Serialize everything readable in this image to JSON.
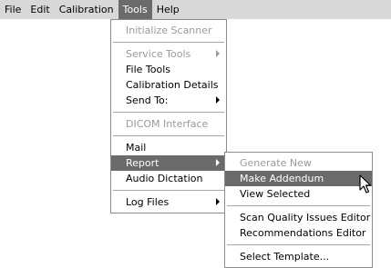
{
  "menubar": {
    "items": [
      {
        "label": "File"
      },
      {
        "label": "Edit"
      },
      {
        "label": "Calibration"
      },
      {
        "label": "Tools"
      },
      {
        "label": "Help"
      }
    ]
  },
  "tools_menu": {
    "initialize_scanner": "Initialize Scanner",
    "service_tools": "Service Tools",
    "file_tools": "File Tools",
    "calibration_details": "Calibration Details",
    "send_to": "Send To:",
    "dicom_interface": "DICOM Interface",
    "mail": "Mail",
    "report": "Report",
    "audio_dictation": "Audio Dictation",
    "log_files": "Log Files"
  },
  "report_menu": {
    "generate_new": "Generate New",
    "make_addendum": "Make Addendum",
    "view_selected": "View Selected",
    "scan_quality_issues_editor": "Scan Quality Issues Editor",
    "recommendations_editor": "Recommendations Editor",
    "select_template": "Select Template..."
  },
  "icons": {
    "submenu_arrow": "chevron-right-icon",
    "cursor": "mouse-pointer-icon"
  },
  "colors": {
    "menubar_bg": "#d8d8d8",
    "highlight": "#6b6b6b",
    "disabled_text": "#9a9a9a"
  }
}
